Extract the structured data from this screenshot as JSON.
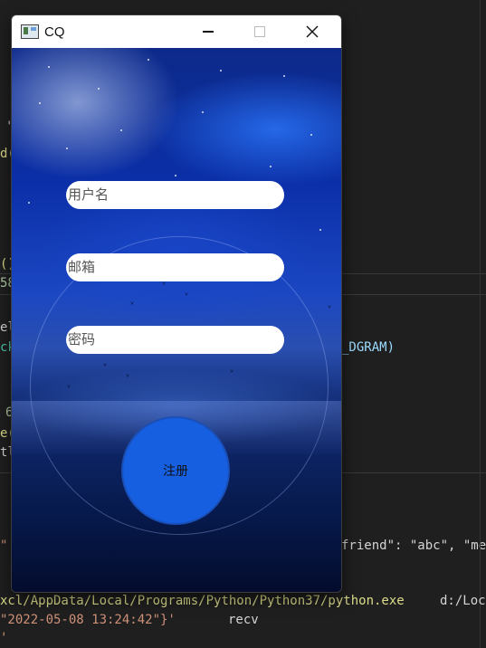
{
  "window": {
    "title": "CQ",
    "close_glyph": "✕"
  },
  "form": {
    "username_placeholder": "用户名",
    "email_placeholder": "邮箱",
    "password_placeholder": "密码",
    "register_label": "注册"
  },
  "editor": {
    "fragments": [
      "'",
      "d(",
      "()",
      "58",
      "el",
      "ck",
      "6",
      "e(",
      "tl",
      "_DGRAM)",
      "\"",
      "friend\": \"abc\", \"me",
      "xcl/AppData/Local/Programs/Python/Python37/python.exe",
      "d:/Loc",
      "\"2022-05-08 13:24:42\"}'",
      "recv",
      "'"
    ]
  },
  "colors": {
    "editor_bg": "#1f1f1f",
    "button_blue": "#155fe0",
    "code_yellow": "#dcdc8b",
    "code_blue": "#9cdcfe",
    "code_string": "#ce9178",
    "code_white": "#d4d4d4"
  },
  "icons": [
    "app-icon",
    "minimize-icon",
    "maximize-icon",
    "close-icon"
  ]
}
